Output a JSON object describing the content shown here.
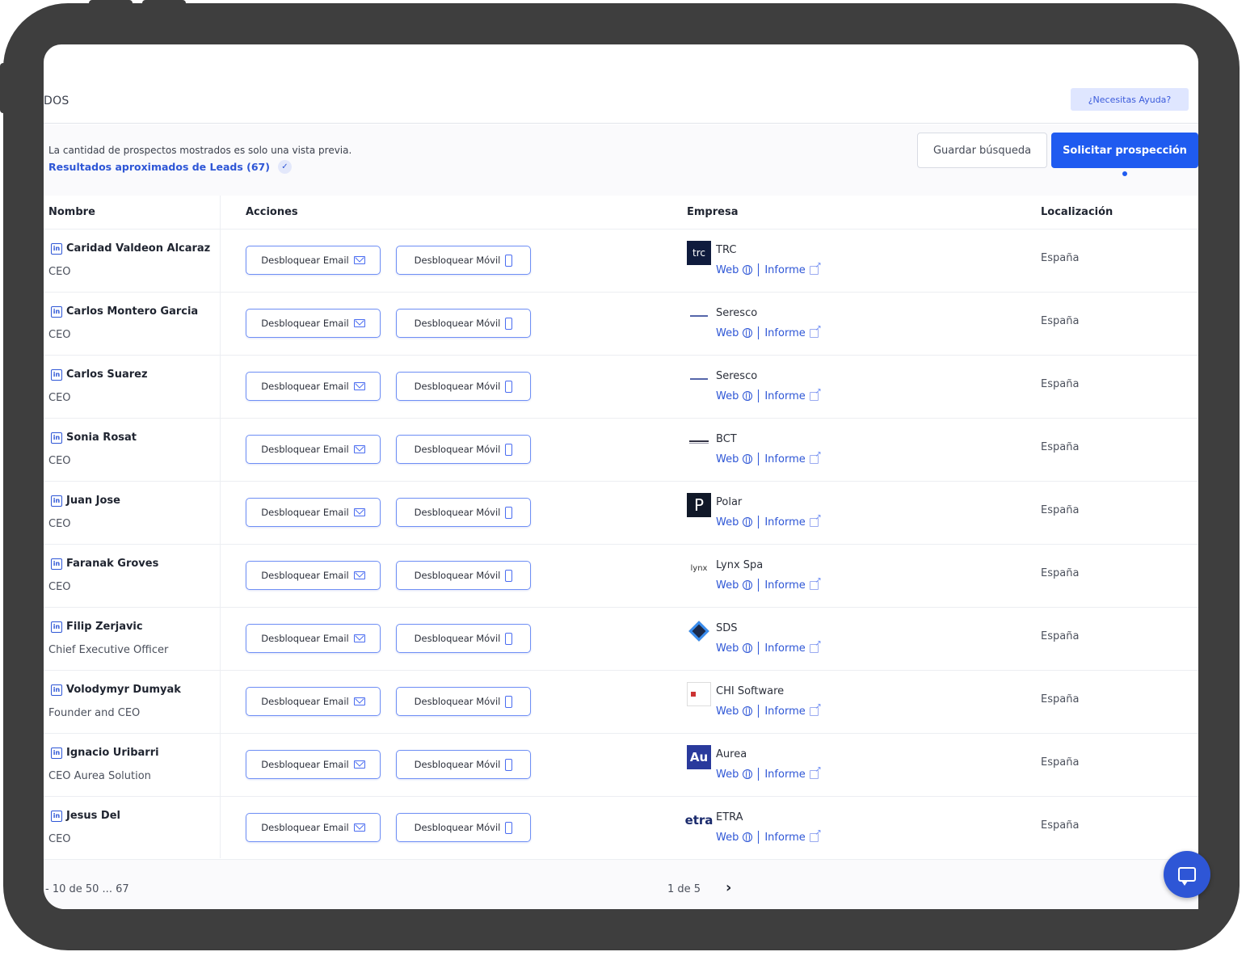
{
  "header": {
    "section_label": "DOS",
    "help_button": "¿Necesitas Ayuda?"
  },
  "toolbar": {
    "notice": "La cantidad de prospectos mostrados es solo una vista previa.",
    "leads_link": "Resultados aproximados de Leads (67)",
    "save_button": "Guardar búsqueda",
    "request_button": "Solicitar prospección"
  },
  "table": {
    "columns": [
      "Nombre",
      "Acciones",
      "Empresa",
      "Localización"
    ],
    "email_button": "Desbloquear Email",
    "mobile_button": "Desbloquear Móvil",
    "web_label": "Web",
    "report_label": "Informe",
    "rows": [
      {
        "name": "Caridad Valdeon Alcaraz",
        "title": "CEO",
        "company": "TRC",
        "logo_text": "trc",
        "location": "España"
      },
      {
        "name": "Carlos Montero Garcia",
        "title": "CEO",
        "company": "Seresco",
        "logo_text": "",
        "location": "España"
      },
      {
        "name": "Carlos Suarez",
        "title": "CEO",
        "company": "Seresco",
        "logo_text": "",
        "location": "España"
      },
      {
        "name": "Sonia Rosat",
        "title": "CEO",
        "company": "BCT",
        "logo_text": "",
        "location": "España"
      },
      {
        "name": "Juan Jose",
        "title": "CEO",
        "company": "Polar",
        "logo_text": "P",
        "location": "España"
      },
      {
        "name": "Faranak Groves",
        "title": "CEO",
        "company": "Lynx Spa",
        "logo_text": "lynx",
        "location": "España"
      },
      {
        "name": "Filip Zerjavic",
        "title": "Chief Executive Officer",
        "company": "SDS",
        "logo_text": "",
        "location": "España"
      },
      {
        "name": "Volodymyr Dumyak",
        "title": "Founder and CEO",
        "company": "CHI Software",
        "logo_text": "",
        "location": "España"
      },
      {
        "name": "Ignacio Uribarri",
        "title": "CEO Aurea Solution",
        "company": "Aurea",
        "logo_text": "Au",
        "location": "España"
      },
      {
        "name": "Jesus Del",
        "title": "CEO",
        "company": "ETRA",
        "logo_text": "etra",
        "location": "España"
      }
    ]
  },
  "footer": {
    "range": "- 10  de  50 ... 67",
    "page": "1 de 5",
    "next": "›"
  },
  "colors": {
    "primary": "#1f5bf0",
    "link": "#2e56d6",
    "frame": "#3e3e3e"
  }
}
